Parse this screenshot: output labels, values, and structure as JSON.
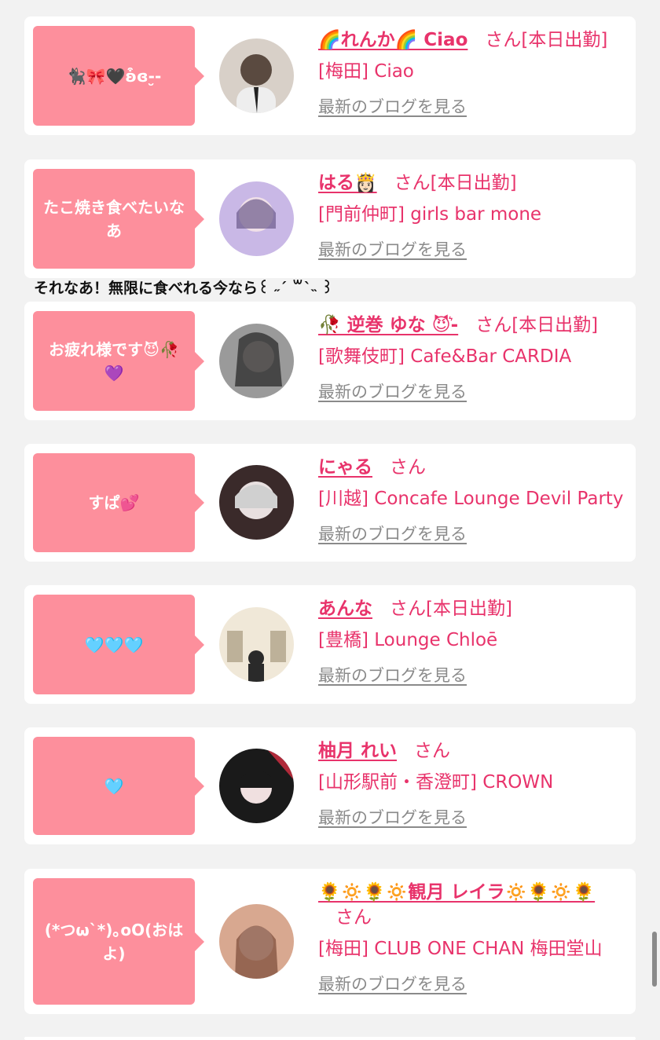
{
  "entries": [
    {
      "message": "🐈‍⬛🎀🖤ʚ͒ɞ-̮-",
      "name": "🌈れんか🌈 Ciao",
      "honorific": "さん",
      "status": "[本日出勤]",
      "shop": "[梅田] Ciao",
      "blog_link": "最新のブログを見る",
      "avatar_colors": [
        "#d8d0c8",
        "#5a4a40"
      ]
    },
    {
      "message": "たこ焼き食べたいなあ",
      "name": "はる👸🏻",
      "honorific": "さん",
      "status": "[本日出勤]",
      "shop": "[門前仲町] girls bar mone",
      "blog_link": "最新のブログを見る",
      "avatar_colors": [
        "#c9b8e6",
        "#6b5a8a"
      ]
    },
    {
      "message": "お疲れ様です😈🥀💜",
      "name": "🥀 逆巻 ゆな 😈͛-",
      "honorific": "さん",
      "status": "[本日出勤]",
      "shop": "[歌舞伎町] Cafe&Bar CARDIA",
      "blog_link": "最新のブログを見る",
      "avatar_colors": [
        "#9a9a9a",
        "#2a2a2a"
      ]
    },
    {
      "message": "すぱ💕",
      "name": "にゃる",
      "honorific": "さん",
      "status": "",
      "shop": "[川越] Concafe Lounge Devil Party",
      "blog_link": "最新のブログを見る",
      "avatar_colors": [
        "#e8e0e0",
        "#3a2a2a"
      ]
    },
    {
      "message": "🩵🩵🩵",
      "name": "あんな",
      "honorific": "さん",
      "status": "[本日出勤]",
      "shop": "[豊橋] Lounge Chloē",
      "blog_link": "最新のブログを見る",
      "avatar_colors": [
        "#f0e8d8",
        "#8a7a5a"
      ]
    },
    {
      "message": "🩵",
      "name": "柚月 れい",
      "honorific": "さん",
      "status": "",
      "shop": "[山形駅前・香澄町] CROWN",
      "blog_link": "最新のブログを見る",
      "avatar_colors": [
        "#b02a3a",
        "#1a1a1a"
      ]
    },
    {
      "message": "(*つω`*)｡oO(おはよ)",
      "name": "🌻🔅🌻🔅観月 レイラ🔅🌻🔅🌻",
      "honorific": "さん",
      "status": "",
      "shop": "[梅田] CLUB ONE CHAN 梅田堂山",
      "blog_link": "最新のブログを見る",
      "avatar_colors": [
        "#d8a890",
        "#6a3a2a"
      ]
    }
  ],
  "reply_text": "それなあ！無限に食べれる今なら꒰ ˶ˊ ꒳ˋ˵ ꒱"
}
